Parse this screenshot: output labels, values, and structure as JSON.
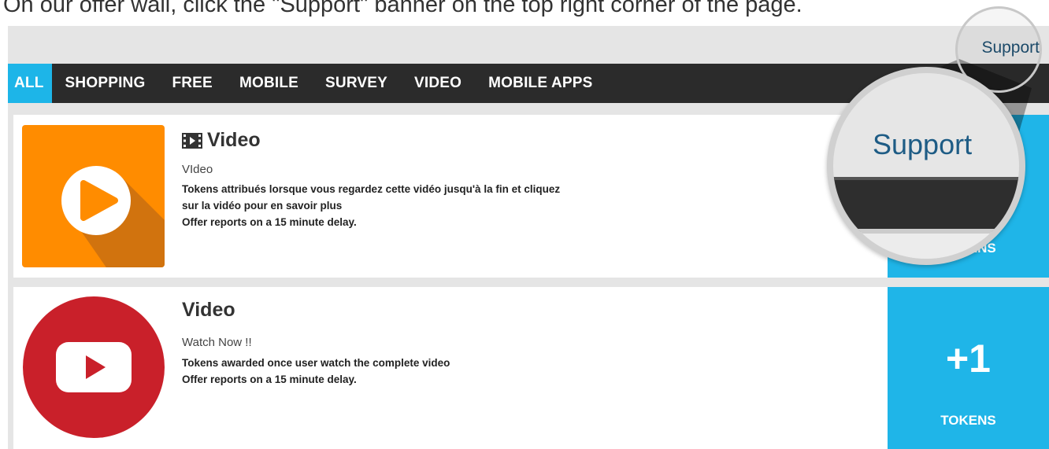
{
  "instruction": {
    "text": "On our offer wall, click the \"Support\" banner on the top right corner of the page."
  },
  "header": {
    "support_label": "Support"
  },
  "nav": {
    "tabs": [
      {
        "label": "ALL",
        "active": true
      },
      {
        "label": "SHOPPING",
        "active": false
      },
      {
        "label": "FREE",
        "active": false
      },
      {
        "label": "MOBILE",
        "active": false
      },
      {
        "label": "SURVEY",
        "active": false
      },
      {
        "label": "VIDEO",
        "active": false
      },
      {
        "label": "MOBILE APPS",
        "active": false
      }
    ]
  },
  "offers": [
    {
      "thumb_icon": "orange-play-icon",
      "title_icon": "film-icon",
      "title": "Video",
      "subtitle": "VIdeo",
      "description_lines": [
        "Tokens attribués lorsque vous regardez cette vidéo jusqu'à la fin et cliquez",
        "sur la vidéo pour en savoir plus",
        "Offer reports on a 15 minute delay."
      ],
      "reward_amount": "",
      "reward_label": "TOKENS"
    },
    {
      "thumb_icon": "youtube-play-icon",
      "title": "Video",
      "subtitle": "Watch Now !!",
      "description_lines": [
        "Tokens awarded once user watch the complete video",
        "Offer reports on a 15 minute delay."
      ],
      "reward_amount": "+1",
      "reward_label": "TOKENS"
    }
  ],
  "magnifier": {
    "label": "Support"
  },
  "colors": {
    "accent": "#1fb5e8",
    "navbar": "#2b2b2b",
    "background": "#e5e5e5",
    "support_text": "#1e4e6e",
    "orange_thumb": "#ff8c00",
    "red_thumb": "#c9202a"
  }
}
